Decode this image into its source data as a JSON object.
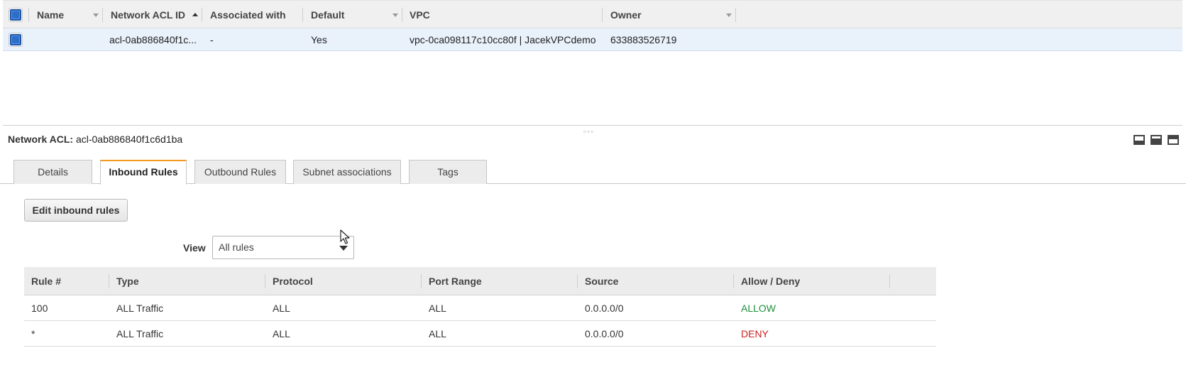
{
  "list_table": {
    "headers": {
      "name": "Name",
      "acl_id": "Network ACL ID",
      "associated": "Associated with",
      "default": "Default",
      "vpc": "VPC",
      "owner": "Owner"
    },
    "rows": [
      {
        "name": "",
        "acl_id": "acl-0ab886840f1c...",
        "associated": "-",
        "default": "Yes",
        "vpc": "vpc-0ca098117c10cc80f | JacekVPCdemo",
        "owner": "633883526719"
      }
    ]
  },
  "detail": {
    "title_label": "Network ACL:",
    "title_value": "acl-0ab886840f1c6d1ba",
    "tabs": [
      {
        "label": "Details",
        "active": false
      },
      {
        "label": "Inbound Rules",
        "active": true
      },
      {
        "label": "Outbound Rules",
        "active": false
      },
      {
        "label": "Subnet associations",
        "active": false
      },
      {
        "label": "Tags",
        "active": false
      }
    ],
    "edit_button": "Edit inbound rules",
    "view_label": "View",
    "view_selected": "All rules"
  },
  "rules_table": {
    "headers": [
      "Rule #",
      "Type",
      "Protocol",
      "Port Range",
      "Source",
      "Allow / Deny"
    ],
    "rows": [
      {
        "rule": "100",
        "type": "ALL Traffic",
        "protocol": "ALL",
        "port_range": "ALL",
        "source": "0.0.0.0/0",
        "action": "ALLOW"
      },
      {
        "rule": "*",
        "type": "ALL Traffic",
        "protocol": "ALL",
        "port_range": "ALL",
        "source": "0.0.0.0/0",
        "action": "DENY"
      }
    ]
  },
  "colors": {
    "allow": "#1d8f3a",
    "deny": "#c8221f",
    "link": "#2a6ebb",
    "active_tab_accent": "#f39a1f"
  }
}
